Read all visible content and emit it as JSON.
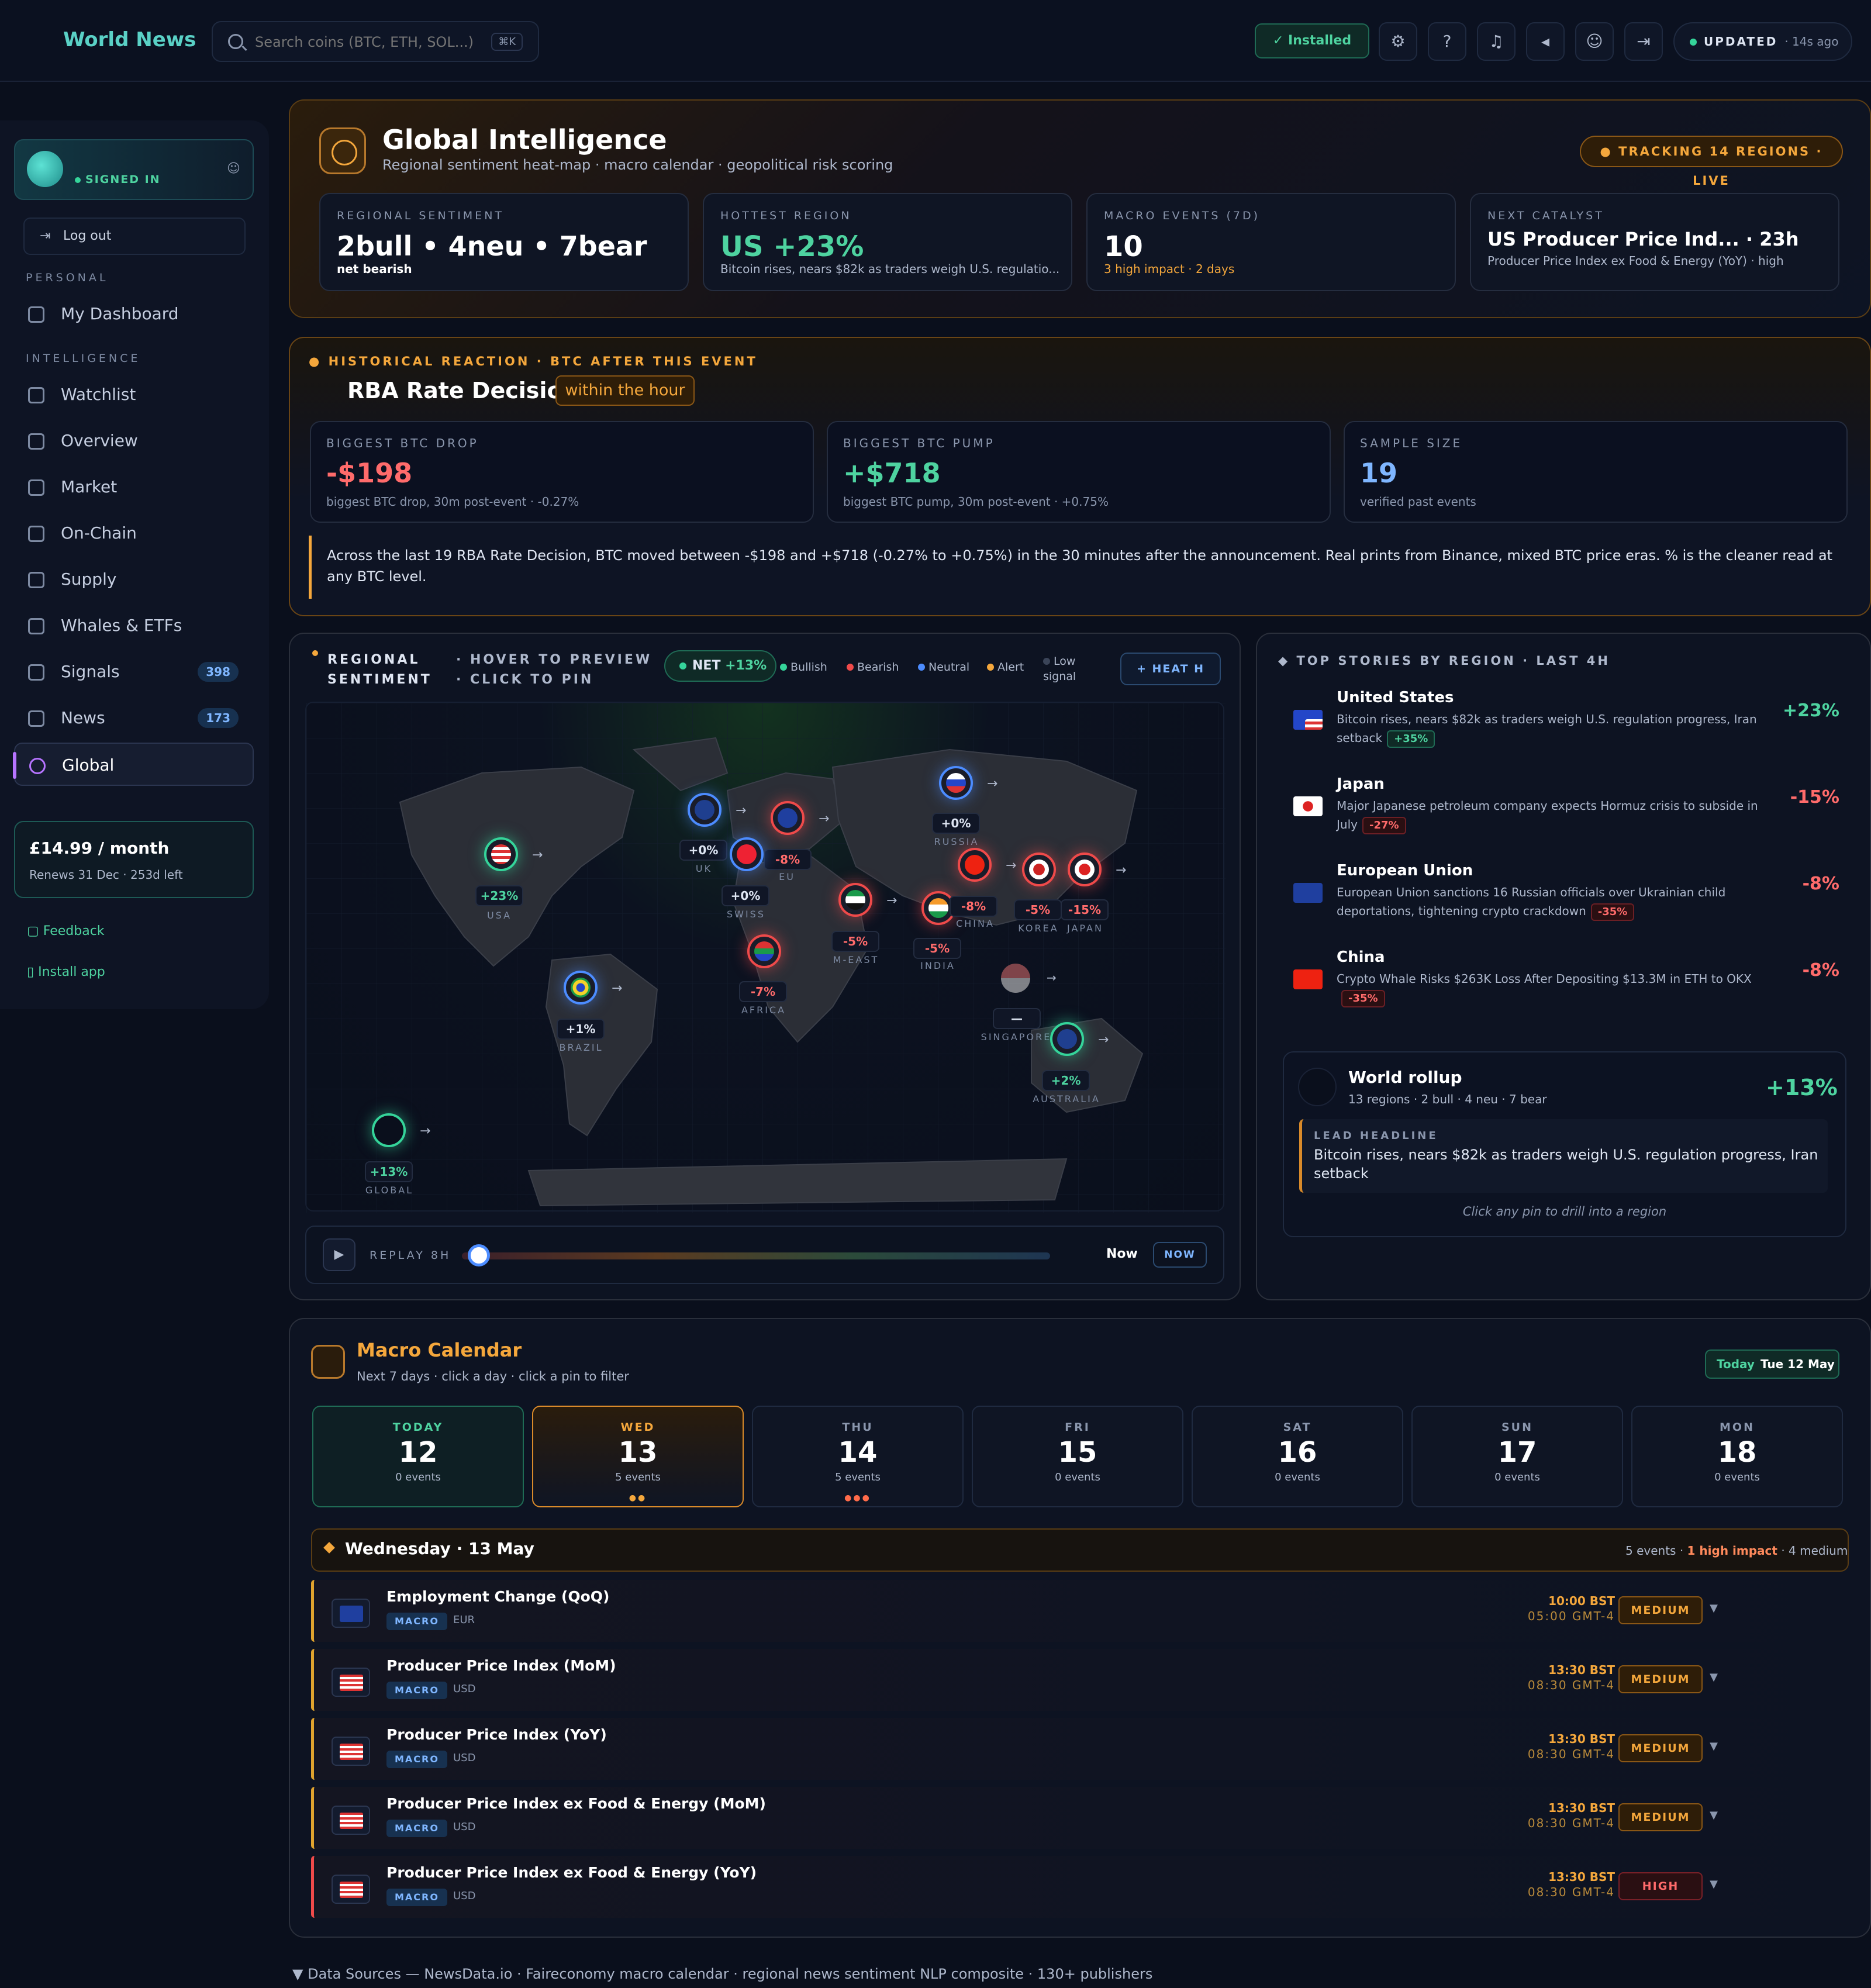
{
  "brand": "World News",
  "search": {
    "placeholder": "Search coins (BTC, ETH, SOL...)",
    "shortcut": "⌘K"
  },
  "topbar": {
    "installed": "✓ Installed",
    "updated_label": "UPDATED",
    "updated_ago": "· 14s ago",
    "icons": [
      "gear-icon",
      "help-icon",
      "bell-icon",
      "speaker-icon",
      "user-icon",
      "logout-icon"
    ]
  },
  "sidebar": {
    "status": "SIGNED IN",
    "logout": "Log out",
    "sections": {
      "personal": "PERSONAL",
      "intelligence": "INTELLIGENCE"
    },
    "items": [
      {
        "label": "My Dashboard",
        "badge": ""
      },
      {
        "label": "Watchlist",
        "badge": ""
      },
      {
        "label": "Overview",
        "badge": ""
      },
      {
        "label": "Market",
        "badge": ""
      },
      {
        "label": "On-Chain",
        "badge": ""
      },
      {
        "label": "Supply",
        "badge": ""
      },
      {
        "label": "Whales & ETFs",
        "badge": ""
      },
      {
        "label": "Signals",
        "badge": "398"
      },
      {
        "label": "News",
        "badge": "173"
      },
      {
        "label": "Global",
        "badge": ""
      }
    ],
    "plan": {
      "price": "£14.99 / month",
      "renews": "Renews 31 Dec · 253d left"
    },
    "feedback": "Feedback",
    "install": "Install app"
  },
  "global": {
    "title": "Global Intelligence",
    "subtitle": "Regional sentiment heat-map · macro calendar · geopolitical risk scoring",
    "tracking": "● TRACKING 14 REGIONS · LIVE",
    "stats": [
      {
        "label": "REGIONAL SENTIMENT",
        "value": "2bull • 4neu • 7bear",
        "sub": "net bearish"
      },
      {
        "label": "HOTTEST REGION",
        "value": "US +23%",
        "sub": "Bitcoin rises, nears $82k as traders weigh U.S. regulatio..."
      },
      {
        "label": "MACRO EVENTS (7D)",
        "value": "10",
        "sub": "3 high impact · 2 days"
      },
      {
        "label": "NEXT CATALYST",
        "value": "US Producer Price Ind... · 23h",
        "sub": "Producer Price Index ex Food & Energy (YoY) · high"
      }
    ]
  },
  "historical": {
    "kicker": "● HISTORICAL REACTION · BTC AFTER THIS EVENT",
    "title": "RBA Rate Decision",
    "chip": "within the hour",
    "cards": [
      {
        "label": "BIGGEST BTC DROP",
        "value": "-$198",
        "sub": "biggest BTC drop, 30m post-event · -0.27%",
        "color": "#ff6b6b"
      },
      {
        "label": "BIGGEST BTC PUMP",
        "value": "+$718",
        "sub": "biggest BTC pump, 30m post-event · +0.75%",
        "color": "#4ed3a0"
      },
      {
        "label": "SAMPLE SIZE",
        "value": "19",
        "sub": "verified past events",
        "color": "#7fb6ff"
      }
    ],
    "note": "Across the last 19 RBA Rate Decision, BTC moved between -$198 and +$718 (-0.27% to +0.75%) in the 30 minutes after the announcement. Real prints from Binance, mixed BTC price eras. % is the cleaner read at any BTC level."
  },
  "regional": {
    "title": "REGIONAL SENTIMENT",
    "hint": "· HOVER TO PREVIEW · CLICK TO PIN",
    "net_label": "NET",
    "net_value": "+13%",
    "legend": [
      {
        "label": "Bullish",
        "color": "#35d49a"
      },
      {
        "label": "Bearish",
        "color": "#ef4a4a"
      },
      {
        "label": "Neutral",
        "color": "#4c8cff"
      },
      {
        "label": "Alert",
        "color": "#f4a73c"
      },
      {
        "label": "Low signal",
        "color": "#3a4458"
      }
    ],
    "heat": "+ HEAT  H",
    "pins": [
      {
        "name": "USA",
        "pct": "+23%",
        "tone": "g",
        "flag": "us"
      },
      {
        "name": "UK",
        "pct": "+0%",
        "tone": "b",
        "flag": "uk"
      },
      {
        "name": "EU",
        "pct": "-8%",
        "tone": "r",
        "flag": "eu"
      },
      {
        "name": "SWISS",
        "pct": "+0%",
        "tone": "b",
        "flag": "ch"
      },
      {
        "name": "RUSSIA",
        "pct": "+0%",
        "tone": "b",
        "flag": "ru"
      },
      {
        "name": "M-EAST",
        "pct": "-5%",
        "tone": "r",
        "flag": "ae"
      },
      {
        "name": "INDIA",
        "pct": "-5%",
        "tone": "r",
        "flag": "in"
      },
      {
        "name": "CHINA",
        "pct": "-8%",
        "tone": "r",
        "flag": "cn"
      },
      {
        "name": "KOREA",
        "pct": "-5%",
        "tone": "r",
        "flag": "kr"
      },
      {
        "name": "JAPAN",
        "pct": "-15%",
        "tone": "r",
        "flag": "jp"
      },
      {
        "name": "AFRICA",
        "pct": "-7%",
        "tone": "r",
        "flag": "za"
      },
      {
        "name": "BRAZIL",
        "pct": "+1%",
        "tone": "b",
        "flag": "br"
      },
      {
        "name": "SINGAPORE",
        "pct": "—",
        "tone": "n",
        "flag": "sg"
      },
      {
        "name": "AUSTRALIA",
        "pct": "+2%",
        "tone": "g",
        "flag": "au"
      },
      {
        "name": "GLOBAL",
        "pct": "+13%",
        "tone": "g",
        "flag": "global"
      }
    ],
    "replay": "REPLAY 8H",
    "now": "Now",
    "now_btn": "NOW"
  },
  "stories": {
    "title": "◆ TOP STORIES BY REGION · LAST 4H",
    "items": [
      {
        "name": "United States",
        "headline": "Bitcoin rises, nears $82k as traders weigh U.S. regulation progress, Iran setback",
        "tag": "+35%",
        "tone": "g",
        "change": "+23%",
        "flag": "us"
      },
      {
        "name": "Japan",
        "headline": "Major Japanese petroleum company expects Hormuz crisis to subside in July",
        "tag": "-27%",
        "tone": "r",
        "change": "-15%",
        "flag": "jp"
      },
      {
        "name": "European Union",
        "headline": "European Union sanctions 16 Russian officials over Ukrainian child deportations, tightening crypto crackdown",
        "tag": "-35%",
        "tone": "r",
        "change": "-8%",
        "flag": "eu"
      },
      {
        "name": "China",
        "headline": "Crypto Whale Risks $263K Loss After Depositing $13.3M in ETH to OKX",
        "tag": "-35%",
        "tone": "r",
        "change": "-8%",
        "flag": "cn"
      }
    ],
    "rollup": {
      "title": "World rollup",
      "sub": "13 regions · 2 bull · 4 neu · 7 bear",
      "value": "+13%",
      "lead_label": "LEAD HEADLINE",
      "lead": "Bitcoin rises, nears $82k as traders weigh U.S. regulation progress, Iran setback",
      "hint": "Click any pin to drill into a region"
    }
  },
  "macro": {
    "title": "Macro Calendar",
    "sub": "Next 7 days · click a day · click a pin to filter",
    "today_label": "Today",
    "today_value": "Tue 12 May",
    "days": [
      {
        "name": "TODAY",
        "num": "12",
        "events": "0 events",
        "dots": ""
      },
      {
        "name": "WED",
        "num": "13",
        "events": "5 events",
        "dots": "●●"
      },
      {
        "name": "THU",
        "num": "14",
        "events": "5 events",
        "dots": "●●●"
      },
      {
        "name": "FRI",
        "num": "15",
        "events": "0 events",
        "dots": ""
      },
      {
        "name": "SAT",
        "num": "16",
        "events": "0 events",
        "dots": ""
      },
      {
        "name": "SUN",
        "num": "17",
        "events": "0 events",
        "dots": ""
      },
      {
        "name": "MON",
        "num": "18",
        "events": "0 events",
        "dots": ""
      }
    ],
    "selected_title": "Wednesday · 13 May",
    "selected_sub_a": "5 events · ",
    "selected_sub_b": "1 high impact",
    "selected_sub_c": " · 4 medium",
    "events": [
      {
        "name": "Employment Change (QoQ)",
        "tag": "MACRO",
        "cur": "EUR",
        "t1": "10:00 BST",
        "t2": "05:00 GMT-4",
        "impact": "MEDIUM",
        "level": "m",
        "flag": "eu"
      },
      {
        "name": "Producer Price Index (MoM)",
        "tag": "MACRO",
        "cur": "USD",
        "t1": "13:30 BST",
        "t2": "08:30 GMT-4",
        "impact": "MEDIUM",
        "level": "m",
        "flag": "us"
      },
      {
        "name": "Producer Price Index (YoY)",
        "tag": "MACRO",
        "cur": "USD",
        "t1": "13:30 BST",
        "t2": "08:30 GMT-4",
        "impact": "MEDIUM",
        "level": "m",
        "flag": "us"
      },
      {
        "name": "Producer Price Index ex Food & Energy (MoM)",
        "tag": "MACRO",
        "cur": "USD",
        "t1": "13:30 BST",
        "t2": "08:30 GMT-4",
        "impact": "MEDIUM",
        "level": "m",
        "flag": "us"
      },
      {
        "name": "Producer Price Index ex Food & Energy (YoY)",
        "tag": "MACRO",
        "cur": "USD",
        "t1": "13:30 BST",
        "t2": "08:30 GMT-4",
        "impact": "HIGH",
        "level": "h",
        "flag": "us"
      }
    ]
  },
  "sources": "▼ Data Sources — NewsData.io · Faireconomy macro calendar · regional news sentiment NLP composite · 130+ publishers"
}
